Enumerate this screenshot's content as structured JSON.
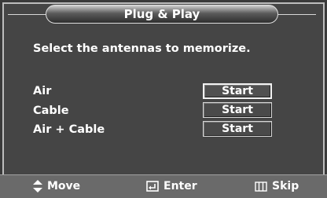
{
  "title": "Plug & Play",
  "prompt": "Select the antennas to memorize.",
  "antennas": [
    {
      "label": "Air",
      "button": "Start"
    },
    {
      "label": "Cable",
      "button": "Start"
    },
    {
      "label": "Air + Cable",
      "button": "Start"
    }
  ],
  "footer": {
    "move": {
      "icon": "updown-arrows-icon",
      "label": "Move"
    },
    "enter": {
      "icon": "enter-icon",
      "label": "Enter"
    },
    "skip": {
      "icon": "menu-icon",
      "label": "Skip"
    }
  }
}
